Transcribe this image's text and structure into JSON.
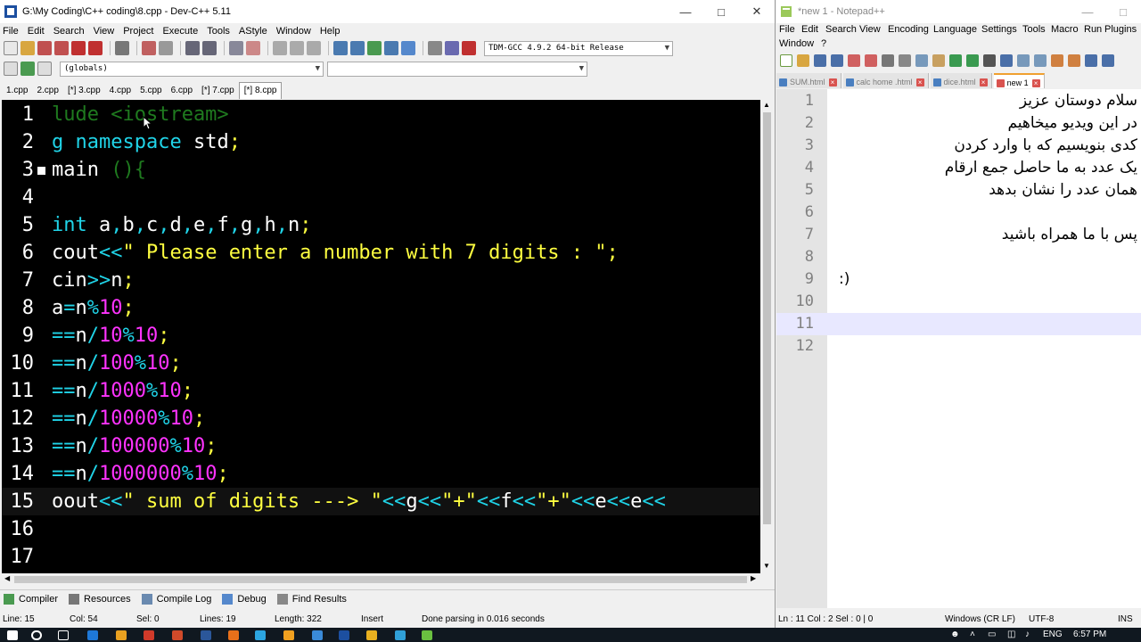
{
  "devcpp": {
    "title": "G:\\My Coding\\C++ coding\\8.cpp - Dev-C++ 5.11",
    "menu": [
      "File",
      "Edit",
      "Search",
      "View",
      "Project",
      "Execute",
      "Tools",
      "AStyle",
      "Window",
      "Help"
    ],
    "compiler_select": "TDM-GCC 4.9.2 64-bit Release",
    "globals_select": "(globals)",
    "file_tabs": [
      "1.cpp",
      "2.cpp",
      "[*] 3.cpp",
      "4.cpp",
      "5.cpp",
      "6.cpp",
      "[*] 7.cpp",
      "[*] 8.cpp"
    ],
    "active_tab_index": 7,
    "code_lines": [
      {
        "n": "1",
        "parts": [
          {
            "t": "lude <iostream>",
            "c": "c-green"
          }
        ]
      },
      {
        "n": "2",
        "parts": [
          {
            "t": "g ",
            "c": "c-cyan"
          },
          {
            "t": "namespace",
            "c": "c-cyan"
          },
          {
            "t": " std",
            "c": "c-wht"
          },
          {
            "t": ";",
            "c": "c-yel"
          }
        ]
      },
      {
        "n": "3",
        "parts": [
          {
            "t": "main ",
            "c": "c-wht"
          },
          {
            "t": "(){",
            "c": "c-green"
          }
        ]
      },
      {
        "n": "4",
        "parts": []
      },
      {
        "n": "5",
        "parts": [
          {
            "t": "int",
            "c": "c-cyan"
          },
          {
            "t": " a",
            "c": "c-wht"
          },
          {
            "t": ",",
            "c": "c-cyan"
          },
          {
            "t": "b",
            "c": "c-wht"
          },
          {
            "t": ",",
            "c": "c-cyan"
          },
          {
            "t": "c",
            "c": "c-wht"
          },
          {
            "t": ",",
            "c": "c-cyan"
          },
          {
            "t": "d",
            "c": "c-wht"
          },
          {
            "t": ",",
            "c": "c-cyan"
          },
          {
            "t": "e",
            "c": "c-wht"
          },
          {
            "t": ",",
            "c": "c-cyan"
          },
          {
            "t": "f",
            "c": "c-wht"
          },
          {
            "t": ",",
            "c": "c-cyan"
          },
          {
            "t": "g",
            "c": "c-wht"
          },
          {
            "t": ",",
            "c": "c-cyan"
          },
          {
            "t": "h",
            "c": "c-wht"
          },
          {
            "t": ",",
            "c": "c-cyan"
          },
          {
            "t": "n",
            "c": "c-wht"
          },
          {
            "t": ";",
            "c": "c-yel"
          }
        ]
      },
      {
        "n": "6",
        "parts": [
          {
            "t": "cout",
            "c": "c-wht"
          },
          {
            "t": "<<",
            "c": "c-cyan"
          },
          {
            "t": "\" Please enter a number with 7 digits : \"",
            "c": "c-yel"
          },
          {
            "t": ";",
            "c": "c-yel"
          }
        ]
      },
      {
        "n": "7",
        "parts": [
          {
            "t": "cin",
            "c": "c-wht"
          },
          {
            "t": ">>",
            "c": "c-cyan"
          },
          {
            "t": "n",
            "c": "c-wht"
          },
          {
            "t": ";",
            "c": "c-yel"
          }
        ]
      },
      {
        "n": "8",
        "parts": [
          {
            "t": "a",
            "c": "c-wht"
          },
          {
            "t": "=",
            "c": "c-cyan"
          },
          {
            "t": "n",
            "c": "c-wht"
          },
          {
            "t": "%",
            "c": "c-cyan"
          },
          {
            "t": "10",
            "c": "c-mag"
          },
          {
            "t": ";",
            "c": "c-yel"
          }
        ]
      },
      {
        "n": "9",
        "parts": [
          {
            "t": "==",
            "c": "c-cyan"
          },
          {
            "t": "n",
            "c": "c-wht"
          },
          {
            "t": "/",
            "c": "c-cyan"
          },
          {
            "t": "10",
            "c": "c-mag"
          },
          {
            "t": "%",
            "c": "c-cyan"
          },
          {
            "t": "10",
            "c": "c-mag"
          },
          {
            "t": ";",
            "c": "c-yel"
          }
        ]
      },
      {
        "n": "10",
        "parts": [
          {
            "t": "==",
            "c": "c-cyan"
          },
          {
            "t": "n",
            "c": "c-wht"
          },
          {
            "t": "/",
            "c": "c-cyan"
          },
          {
            "t": "100",
            "c": "c-mag"
          },
          {
            "t": "%",
            "c": "c-cyan"
          },
          {
            "t": "10",
            "c": "c-mag"
          },
          {
            "t": ";",
            "c": "c-yel"
          }
        ]
      },
      {
        "n": "11",
        "parts": [
          {
            "t": "==",
            "c": "c-cyan"
          },
          {
            "t": "n",
            "c": "c-wht"
          },
          {
            "t": "/",
            "c": "c-cyan"
          },
          {
            "t": "1000",
            "c": "c-mag"
          },
          {
            "t": "%",
            "c": "c-cyan"
          },
          {
            "t": "10",
            "c": "c-mag"
          },
          {
            "t": ";",
            "c": "c-yel"
          }
        ]
      },
      {
        "n": "12",
        "parts": [
          {
            "t": "==",
            "c": "c-cyan"
          },
          {
            "t": "n",
            "c": "c-wht"
          },
          {
            "t": "/",
            "c": "c-cyan"
          },
          {
            "t": "10000",
            "c": "c-mag"
          },
          {
            "t": "%",
            "c": "c-cyan"
          },
          {
            "t": "10",
            "c": "c-mag"
          },
          {
            "t": ";",
            "c": "c-yel"
          }
        ]
      },
      {
        "n": "13",
        "parts": [
          {
            "t": "==",
            "c": "c-cyan"
          },
          {
            "t": "n",
            "c": "c-wht"
          },
          {
            "t": "/",
            "c": "c-cyan"
          },
          {
            "t": "100000",
            "c": "c-mag"
          },
          {
            "t": "%",
            "c": "c-cyan"
          },
          {
            "t": "10",
            "c": "c-mag"
          },
          {
            "t": ";",
            "c": "c-yel"
          }
        ]
      },
      {
        "n": "14",
        "parts": [
          {
            "t": "==",
            "c": "c-cyan"
          },
          {
            "t": "n",
            "c": "c-wht"
          },
          {
            "t": "/",
            "c": "c-cyan"
          },
          {
            "t": "1000000",
            "c": "c-mag"
          },
          {
            "t": "%",
            "c": "c-cyan"
          },
          {
            "t": "10",
            "c": "c-mag"
          },
          {
            "t": ";",
            "c": "c-yel"
          }
        ]
      },
      {
        "n": "15",
        "cur": true,
        "parts": [
          {
            "t": "oout",
            "c": "c-wht"
          },
          {
            "t": "<<",
            "c": "c-cyan"
          },
          {
            "t": "\" sum of digits ---> \"",
            "c": "c-yel"
          },
          {
            "t": "<<",
            "c": "c-cyan"
          },
          {
            "t": "g",
            "c": "c-wht"
          },
          {
            "t": "<<",
            "c": "c-cyan"
          },
          {
            "t": "\"+\"",
            "c": "c-yel"
          },
          {
            "t": "<<",
            "c": "c-cyan"
          },
          {
            "t": "f",
            "c": "c-wht"
          },
          {
            "t": "<<",
            "c": "c-cyan"
          },
          {
            "t": "\"+\"",
            "c": "c-yel"
          },
          {
            "t": "<<",
            "c": "c-cyan"
          },
          {
            "t": "e",
            "c": "c-wht"
          },
          {
            "t": "<<",
            "c": "c-cyan"
          },
          {
            "t": "e",
            "c": "c-wht"
          },
          {
            "t": "<<",
            "c": "c-cyan"
          }
        ]
      },
      {
        "n": "16",
        "parts": []
      },
      {
        "n": "17",
        "parts": []
      }
    ],
    "bottom_tabs": [
      "Compiler",
      "Resources",
      "Compile Log",
      "Debug",
      "Find Results"
    ],
    "status": {
      "line": "Line:  15",
      "col": "Col:  54",
      "sel": "Sel:  0",
      "lines": "Lines:  19",
      "length": "Length:  322",
      "mode": "Insert",
      "message": "Done parsing in 0.016 seconds"
    }
  },
  "notepadpp": {
    "title": "*new 1 - Notepad++",
    "menu": [
      "File",
      "Edit",
      "Search",
      "View",
      "Encoding",
      "Language",
      "Settings",
      "Tools",
      "Macro",
      "Run",
      "Plugins",
      "Window",
      "?"
    ],
    "tabs": [
      "SUM.html",
      "calc home .html",
      "dice.html",
      "new 1"
    ],
    "active_tab_index": 3,
    "lines": [
      {
        "n": "1",
        "t": "سلام دوستان عزیز"
      },
      {
        "n": "2",
        "t": "در این ویدیو میخاهیم"
      },
      {
        "n": "3",
        "t": "کدی بنویسیم که با وارد کردن"
      },
      {
        "n": "4",
        "t": "یک عدد به ما حاصل جمع ارقام"
      },
      {
        "n": "5",
        "t": "همان عدد را نشان بدهد"
      },
      {
        "n": "6",
        "t": ""
      },
      {
        "n": "7",
        "t": "پس با ما همراه باشید"
      },
      {
        "n": "8",
        "t": ""
      },
      {
        "n": "9",
        "t": ":)",
        "ltr": true
      },
      {
        "n": "10",
        "t": ""
      },
      {
        "n": "11",
        "t": "",
        "cur": true
      },
      {
        "n": "12",
        "t": ""
      }
    ],
    "status": {
      "pos": "Ln : 11    Col : 2    Sel : 0 | 0",
      "eol": "Windows (CR LF)",
      "enc": "UTF-8",
      "ins": "INS"
    }
  },
  "taskbar": {
    "lang": "ENG",
    "time": "6:57 PM"
  }
}
